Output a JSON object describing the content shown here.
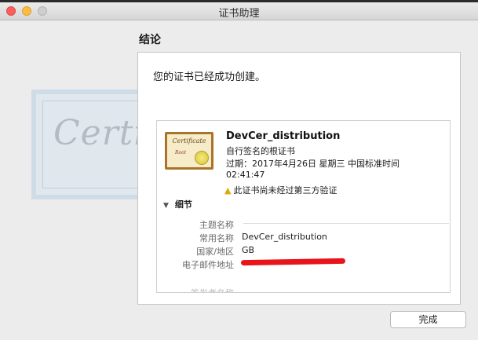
{
  "window": {
    "title": "证书助理"
  },
  "heading": "结论",
  "message": "您的证书已经成功创建。",
  "background_text": "Certif",
  "certificate": {
    "icon_title": "Certificate",
    "icon_subtitle": "Root",
    "name": "DevCer_distribution",
    "kind": "自行签名的根证书",
    "expiry_line1": "过期：2017年4月26日 星期三 中国标准时间",
    "expiry_line2": "02:41:47",
    "warning": "此证书尚未经过第三方验证"
  },
  "details": {
    "section_label": "细节",
    "rows": [
      {
        "label": "主题名称",
        "value": ""
      },
      {
        "label": "常用名称",
        "value": "DevCer_distribution"
      },
      {
        "label": "国家/地区",
        "value": "GB"
      },
      {
        "label": "电子邮件地址",
        "value": ""
      },
      {
        "label": "签发者名称",
        "value": ""
      }
    ]
  },
  "buttons": {
    "done": "完成"
  },
  "colors": {
    "redaction": "#e8141a",
    "warning": "#e0a800"
  }
}
